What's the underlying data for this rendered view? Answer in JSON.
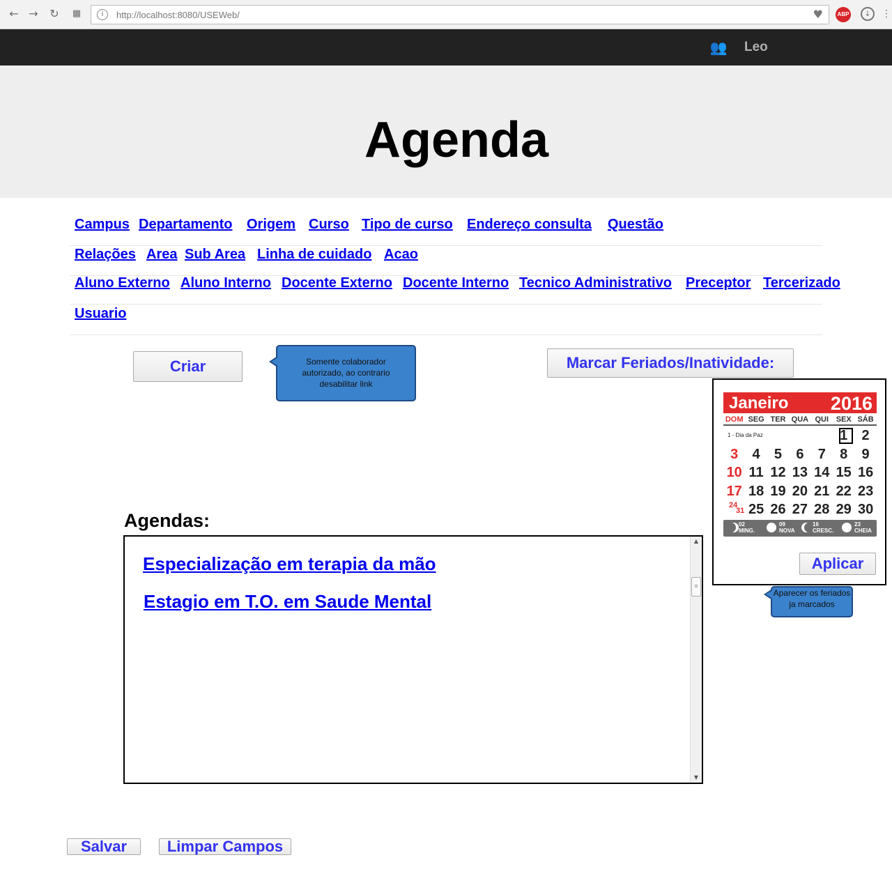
{
  "browser": {
    "url": "http://localhost:8080/USEWeb/",
    "abp_label": "ABP"
  },
  "header": {
    "user_name": "Leo",
    "title": "Agenda"
  },
  "nav": {
    "row1": [
      "Campus",
      "Departamento",
      "Origem",
      "Curso",
      "Tipo de curso",
      "Endereço consulta",
      "Questão"
    ],
    "row2": [
      "Relações",
      "Area",
      "Sub Area",
      "Linha de cuidado",
      "Acao"
    ],
    "row3": [
      "Aluno Externo",
      "Aluno Interno",
      "Docente Externo",
      "Docente Interno",
      "Tecnico Administrativo",
      "Preceptor",
      "Tercerizado"
    ],
    "row4": [
      "Usuario"
    ]
  },
  "actions": {
    "create_label": "Criar",
    "create_note": "Somente colaborador autorizado, ao contrario desabilitar link",
    "holidays_label": "Marcar Feriados/Inatividade:"
  },
  "calendar": {
    "month": "Janeiro",
    "year": "2016",
    "weekdays": [
      "DOM",
      "SEG",
      "TER",
      "QUA",
      "QUI",
      "SEX",
      "SÁB"
    ],
    "holiday_note": "1 - Dia da Paz",
    "weeks": [
      [
        "",
        "",
        "",
        "",
        "",
        "1",
        "2"
      ],
      [
        "3",
        "4",
        "5",
        "6",
        "7",
        "8",
        "9"
      ],
      [
        "10",
        "11",
        "12",
        "13",
        "14",
        "15",
        "16"
      ],
      [
        "17",
        "18",
        "19",
        "20",
        "21",
        "22",
        "23"
      ],
      [
        "",
        "25",
        "26",
        "27",
        "28",
        "29",
        "30"
      ]
    ],
    "split_day_top": "24",
    "split_day_bottom": "31",
    "moon_phases": [
      {
        "day": "02",
        "name": "MING."
      },
      {
        "day": "09",
        "name": "NOVA"
      },
      {
        "day": "16",
        "name": "CRESC."
      },
      {
        "day": "23",
        "name": "CHEIA"
      }
    ],
    "apply_label": "Aplicar",
    "apply_note": "Aparecer os feriados ja marcados",
    "colors": {
      "header": "#e32b2b",
      "sunday": "#e32b2b"
    }
  },
  "agendas": {
    "label": "Agendas:",
    "items": [
      "Especialização em terapia da mão",
      "Estagio em T.O. em Saude Mental"
    ]
  },
  "footer": {
    "save_label": "Salvar",
    "clear_label": "Limpar Campos"
  }
}
